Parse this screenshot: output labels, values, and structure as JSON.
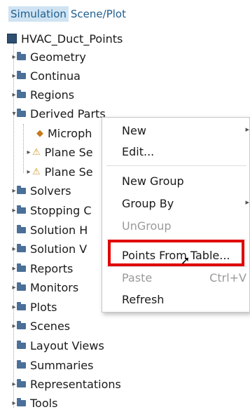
{
  "tabs": [
    "Simulation",
    "Scene/Plot"
  ],
  "root": "HVAC_Duct_Points",
  "tree": [
    {
      "label": "Geometry",
      "icon": "folder-icon"
    },
    {
      "label": "Continua",
      "icon": "folder-icon"
    },
    {
      "label": "Regions",
      "icon": "folder-icon"
    },
    {
      "label": "Derived Parts",
      "icon": "folder-icon"
    },
    {
      "label": "Microph",
      "icon": "point-probe-icon"
    },
    {
      "label": "Plane Se",
      "icon": "plane-section-icon"
    },
    {
      "label": "Plane Se",
      "icon": "plane-section-icon"
    },
    {
      "label": "Solvers",
      "icon": "folder-icon"
    },
    {
      "label": "Stopping C",
      "icon": "folder-icon"
    },
    {
      "label": "Solution H",
      "icon": "folder-icon"
    },
    {
      "label": "Solution V",
      "icon": "folder-icon"
    },
    {
      "label": "Reports",
      "icon": "folder-icon"
    },
    {
      "label": "Monitors",
      "icon": "folder-icon"
    },
    {
      "label": "Plots",
      "icon": "folder-icon"
    },
    {
      "label": "Scenes",
      "icon": "folder-icon"
    },
    {
      "label": "Layout Views",
      "icon": "folder-icon"
    },
    {
      "label": "Summaries",
      "icon": "folder-icon"
    },
    {
      "label": "Representations",
      "icon": "folder-icon"
    },
    {
      "label": "Tools",
      "icon": "folder-icon"
    }
  ],
  "context_menu": {
    "new": "New",
    "edit": "Edit...",
    "new_group": "New Group",
    "group_by": "Group By",
    "ungroup": "UnGroup",
    "points_from_table": "Points From Table...",
    "paste": "Paste",
    "paste_shortcut": "Ctrl+V",
    "refresh": "Refresh"
  },
  "colors": {
    "highlight_border": "#e00000",
    "active_tab_bg": "#cfe3f3",
    "folder_icon": "#4a6f98"
  }
}
